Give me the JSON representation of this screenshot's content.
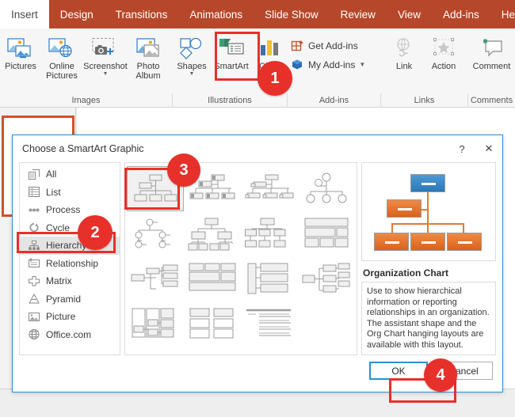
{
  "ribbon": {
    "tabs": [
      {
        "label": "Insert",
        "active": true
      },
      {
        "label": "Design",
        "active": false
      },
      {
        "label": "Transitions",
        "active": false
      },
      {
        "label": "Animations",
        "active": false
      },
      {
        "label": "Slide Show",
        "active": false
      },
      {
        "label": "Review",
        "active": false
      },
      {
        "label": "View",
        "active": false
      },
      {
        "label": "Add-ins",
        "active": false
      },
      {
        "label": "Help",
        "active": false
      }
    ],
    "tell_me_icon": "lightbulb-icon",
    "groups": {
      "images": {
        "label": "Images",
        "buttons": [
          {
            "name": "pictures",
            "label": "Pictures",
            "icon": "pictures-icon",
            "caret": false
          },
          {
            "name": "online-pictures",
            "label": "Online Pictures",
            "icon": "online-pictures-icon",
            "caret": false
          },
          {
            "name": "screenshot",
            "label": "Screenshot",
            "icon": "screenshot-icon",
            "caret": true
          },
          {
            "name": "photo-album",
            "label": "Photo Album",
            "icon": "photo-album-icon",
            "caret": true
          }
        ]
      },
      "illustrations": {
        "label": "Illustrations",
        "buttons": [
          {
            "name": "shapes",
            "label": "Shapes",
            "icon": "shapes-icon",
            "caret": true
          },
          {
            "name": "smartart",
            "label": "SmartArt",
            "icon": "smartart-icon",
            "caret": false
          },
          {
            "name": "chart",
            "label": "Chart",
            "icon": "chart-icon",
            "caret": false
          }
        ]
      },
      "addins": {
        "label": "Add-ins",
        "buttons": [
          {
            "name": "get-add-ins",
            "label": "Get Add-ins",
            "icon": "store-icon",
            "caret": false
          },
          {
            "name": "my-add-ins",
            "label": "My Add-ins",
            "icon": "my-add-ins-icon",
            "caret": true
          }
        ]
      },
      "links": {
        "label": "Links",
        "buttons": [
          {
            "name": "link",
            "label": "Link",
            "icon": "link-icon",
            "disabled": true
          },
          {
            "name": "action",
            "label": "Action",
            "icon": "action-icon",
            "disabled": true
          }
        ]
      },
      "comments": {
        "label": "Comments",
        "buttons": [
          {
            "name": "comment",
            "label": "Comment",
            "icon": "comment-icon",
            "caret": false
          }
        ]
      }
    }
  },
  "dialog": {
    "title": "Choose a SmartArt Graphic",
    "help_label": "?",
    "close_label": "✕",
    "categories": [
      {
        "label": "All",
        "icon": "all-icon",
        "selected": false
      },
      {
        "label": "List",
        "icon": "list-icon",
        "selected": false
      },
      {
        "label": "Process",
        "icon": "process-icon",
        "selected": false
      },
      {
        "label": "Cycle",
        "icon": "cycle-icon",
        "selected": false
      },
      {
        "label": "Hierarchy",
        "icon": "hierarchy-icon",
        "selected": true
      },
      {
        "label": "Relationship",
        "icon": "relationship-icon",
        "selected": false
      },
      {
        "label": "Matrix",
        "icon": "matrix-icon",
        "selected": false
      },
      {
        "label": "Pyramid",
        "icon": "pyramid-icon",
        "selected": false
      },
      {
        "label": "Picture",
        "icon": "picture-icon",
        "selected": false
      },
      {
        "label": "Office.com",
        "icon": "office-com-icon",
        "selected": false
      }
    ],
    "gallery": [
      {
        "name": "organization-chart",
        "shape": "org",
        "selected": true
      },
      {
        "name": "picture-organization-chart",
        "shape": "pic-org",
        "selected": false
      },
      {
        "name": "name-and-title-organization-chart",
        "shape": "name-title",
        "selected": false
      },
      {
        "name": "half-circle-organization-chart",
        "shape": "half-circle",
        "selected": false
      },
      {
        "name": "circle-picture-hierarchy",
        "shape": "circle-hier",
        "selected": false
      },
      {
        "name": "hierarchy",
        "shape": "hierarchy",
        "selected": false
      },
      {
        "name": "labeled-hierarchy",
        "shape": "labeled-hier",
        "selected": false
      },
      {
        "name": "table-hierarchy",
        "shape": "table-hier",
        "selected": false
      },
      {
        "name": "horizontal-organization-chart",
        "shape": "horiz-org",
        "selected": false
      },
      {
        "name": "table-list",
        "shape": "table-list",
        "selected": false
      },
      {
        "name": "architecture-layout",
        "shape": "architecture",
        "selected": false
      },
      {
        "name": "horizontal-multi-level-hierarchy",
        "shape": "horiz-multi",
        "selected": false
      },
      {
        "name": "horizontal-hierarchy",
        "shape": "horiz-hier",
        "selected": false
      },
      {
        "name": "horizontal-labeled-hierarchy",
        "shape": "horiz-labeled",
        "selected": false
      },
      {
        "name": "lined-list",
        "shape": "lined-list",
        "selected": false
      }
    ],
    "preview": {
      "art_name": "organization-chart-preview",
      "title": "Organization Chart",
      "description": "Use to show hierarchical information or reporting relationships in an organization. The assistant shape and the Org Chart hanging layouts are available with this layout."
    },
    "ok_label": "OK",
    "cancel_label": "Cancel"
  },
  "annotations": [
    {
      "number": "1",
      "target": "smartart-button"
    },
    {
      "number": "2",
      "target": "hierarchy-category"
    },
    {
      "number": "3",
      "target": "organization-chart-thumbnail"
    },
    {
      "number": "4",
      "target": "ok-button"
    }
  ],
  "colors": {
    "ribbon": "#b7472a",
    "annotation": "#e8302a",
    "dialog_border": "#2b8fd4",
    "preview_top_box": "#2a78b8",
    "preview_other_box": "#d9621d"
  }
}
